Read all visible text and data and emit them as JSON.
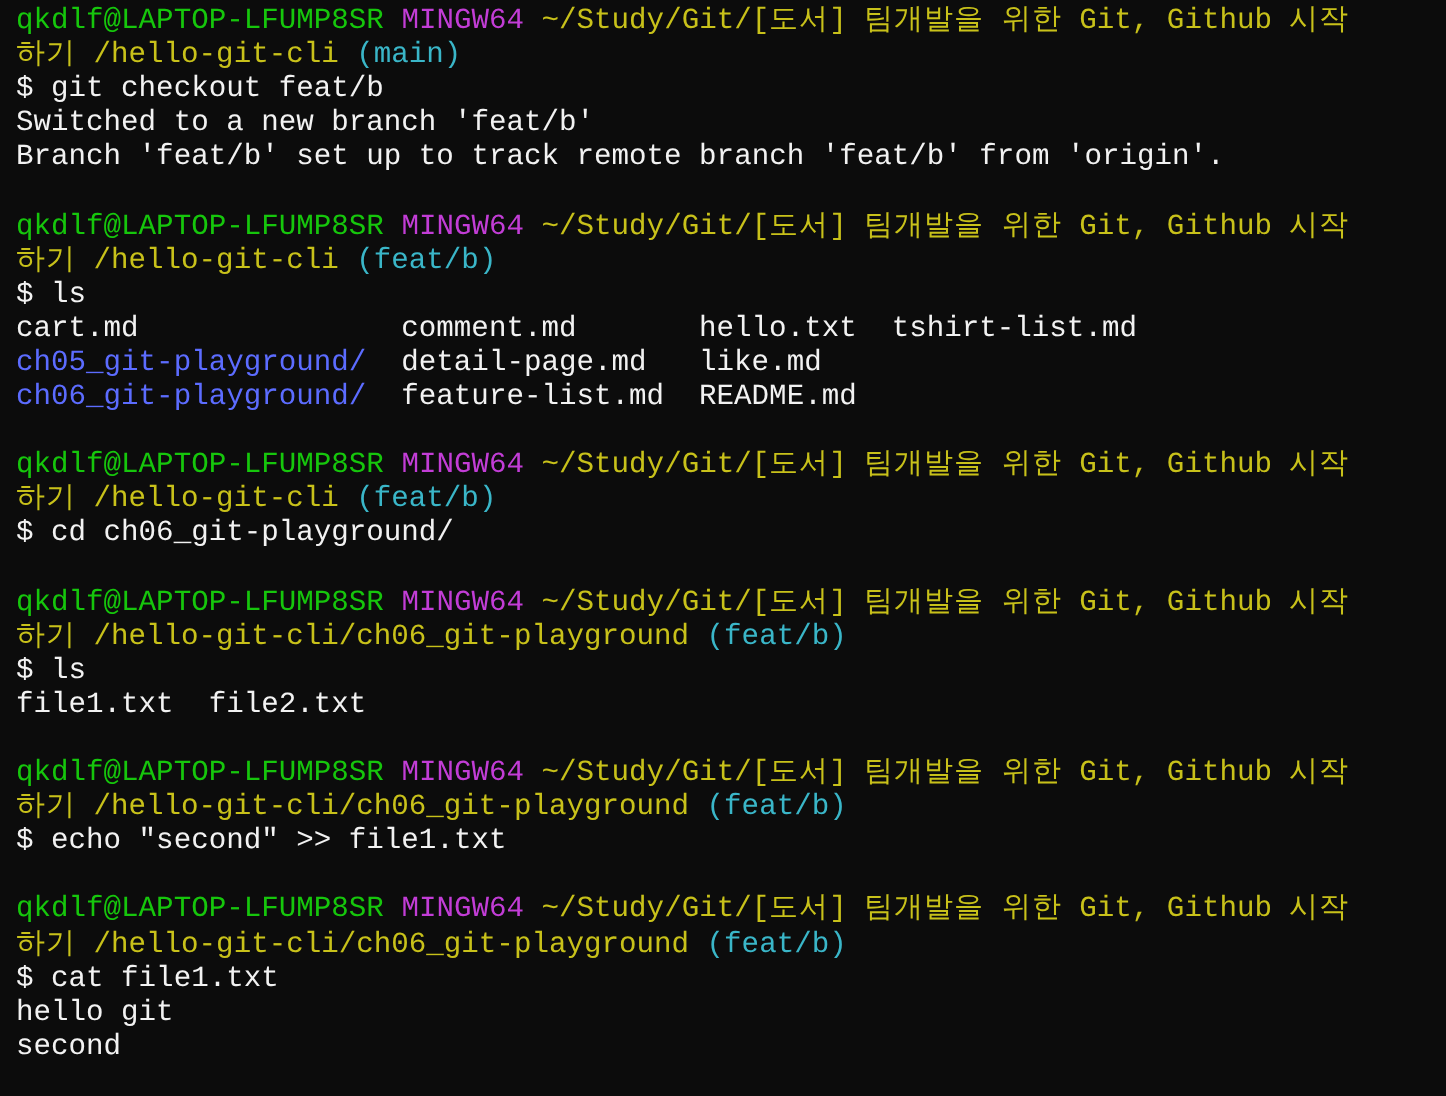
{
  "terminal": {
    "entries": [
      {
        "prompt": {
          "user": "qkdlf@LAPTOP-LFUMP8SR",
          "system": "MINGW64",
          "path_line_1": "~/Study/Git/[도서] 팀개발을 위한 Git, Github 시작",
          "path_line_2": "하기 /hello-git-cli",
          "branch": "(main)"
        },
        "command": "$ git checkout feat/b",
        "output": [
          {
            "kind": "text",
            "text": "Switched to a new branch 'feat/b'"
          },
          {
            "kind": "text",
            "text": "Branch 'feat/b' set up to track remote branch 'feat/b' from 'origin'."
          }
        ]
      },
      {
        "prompt": {
          "user": "qkdlf@LAPTOP-LFUMP8SR",
          "system": "MINGW64",
          "path_line_1": "~/Study/Git/[도서] 팀개발을 위한 Git, Github 시작",
          "path_line_2": "하기 /hello-git-cli",
          "branch": "(feat/b)"
        },
        "command": "$ ls",
        "output": [
          {
            "kind": "listing",
            "rows": [
              [
                {
                  "name": "cart.md",
                  "kind": "file"
                },
                {
                  "name": "comment.md",
                  "kind": "file"
                },
                {
                  "name": "hello.txt",
                  "kind": "file"
                },
                {
                  "name": "tshirt-list.md",
                  "kind": "file"
                }
              ],
              [
                {
                  "name": "ch05_git-playground/",
                  "kind": "dir"
                },
                {
                  "name": "detail-page.md",
                  "kind": "file"
                },
                {
                  "name": "like.md",
                  "kind": "file"
                }
              ],
              [
                {
                  "name": "ch06_git-playground/",
                  "kind": "dir"
                },
                {
                  "name": "feature-list.md",
                  "kind": "file"
                },
                {
                  "name": "README.md",
                  "kind": "file"
                }
              ]
            ]
          }
        ]
      },
      {
        "prompt": {
          "user": "qkdlf@LAPTOP-LFUMP8SR",
          "system": "MINGW64",
          "path_line_1": "~/Study/Git/[도서] 팀개발을 위한 Git, Github 시작",
          "path_line_2": "하기 /hello-git-cli",
          "branch": "(feat/b)"
        },
        "command": "$ cd ch06_git-playground/"
      },
      {
        "prompt": {
          "user": "qkdlf@LAPTOP-LFUMP8SR",
          "system": "MINGW64",
          "path_line_1": "~/Study/Git/[도서] 팀개발을 위한 Git, Github 시작",
          "path_line_2": "하기 /hello-git-cli/ch06_git-playground",
          "branch": "(feat/b)"
        },
        "command": "$ ls",
        "output": [
          {
            "kind": "listing",
            "rows": [
              [
                {
                  "name": "file1.txt",
                  "kind": "file"
                },
                {
                  "name": "file2.txt",
                  "kind": "file"
                }
              ]
            ]
          }
        ]
      },
      {
        "prompt": {
          "user": "qkdlf@LAPTOP-LFUMP8SR",
          "system": "MINGW64",
          "path_line_1": "~/Study/Git/[도서] 팀개발을 위한 Git, Github 시작",
          "path_line_2": "하기 /hello-git-cli/ch06_git-playground",
          "branch": "(feat/b)"
        },
        "command": "$ echo \"second\" >> file1.txt"
      },
      {
        "prompt": {
          "user": "qkdlf@LAPTOP-LFUMP8SR",
          "system": "MINGW64",
          "path_line_1": "~/Study/Git/[도서] 팀개발을 위한 Git, Github 시작",
          "path_line_2": "하기 /hello-git-cli/ch06_git-playground",
          "branch": "(feat/b)"
        },
        "command": "$ cat file1.txt",
        "output": [
          {
            "kind": "text",
            "text": "hello git"
          },
          {
            "kind": "text",
            "text": "second"
          }
        ]
      }
    ]
  }
}
